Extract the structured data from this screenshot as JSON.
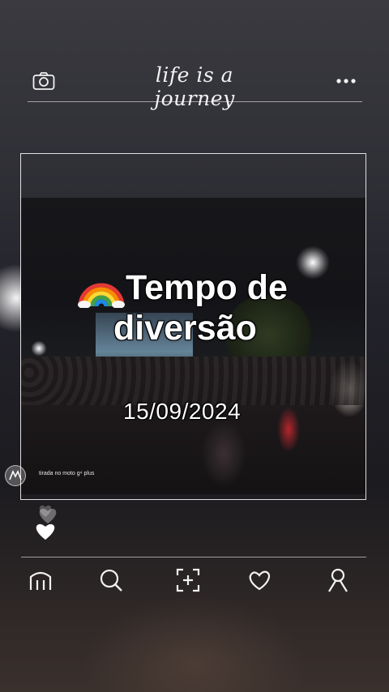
{
  "header": {
    "tagline": "life is a journey",
    "camera_icon": "camera-icon",
    "more_icon": "more-dots-icon"
  },
  "post": {
    "title_line1": "Tempo de",
    "title_line2": "diversão",
    "title_emoji": "rainbow",
    "date": "15/09/2024",
    "watermark": "tirada no moto g⁴ plus"
  },
  "nav": {
    "items": [
      {
        "icon": "home-icon"
      },
      {
        "icon": "search-icon"
      },
      {
        "icon": "add-post-icon"
      },
      {
        "icon": "heart-icon"
      },
      {
        "icon": "profile-icon"
      }
    ]
  },
  "colors": {
    "text": "#ffffff",
    "rainbow": [
      "#e53935",
      "#fb8c00",
      "#fdd835",
      "#43a047",
      "#1e88e5",
      "#8e24aa"
    ]
  }
}
